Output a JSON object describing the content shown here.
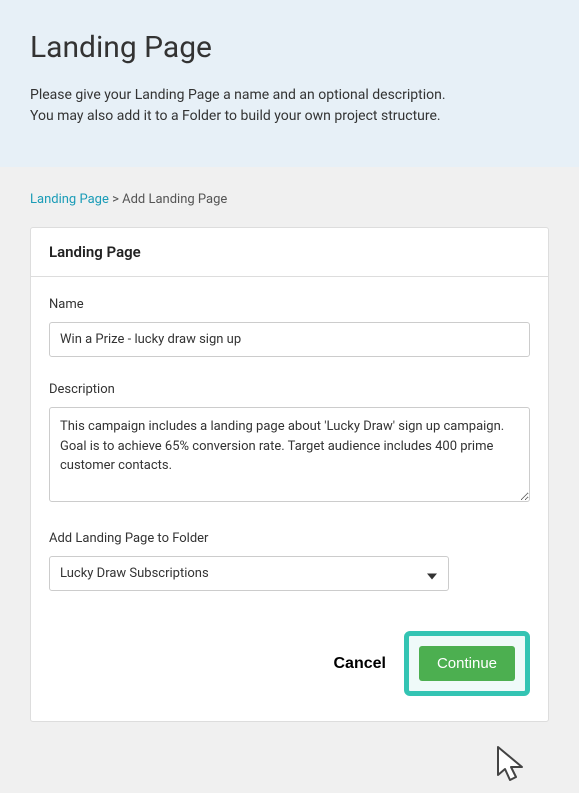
{
  "header": {
    "title": "Landing Page",
    "subtitle": "Please give your Landing Page a name and an optional description.\nYou may also add it to a Folder to build your own project structure."
  },
  "breadcrumb": {
    "link": "Landing Page",
    "separator": " > ",
    "current": "Add Landing Page"
  },
  "card": {
    "title": "Landing Page"
  },
  "form": {
    "name_label": "Name",
    "name_value": "Win a Prize - lucky draw sign up",
    "description_label": "Description",
    "description_value": "This campaign includes a landing page about 'Lucky Draw' sign up campaign. Goal is to achieve 65% conversion rate. Target audience includes 400 prime customer contacts.",
    "folder_label": "Add Landing Page to Folder",
    "folder_value": "Lucky Draw Subscriptions"
  },
  "buttons": {
    "cancel": "Cancel",
    "continue": "Continue"
  }
}
